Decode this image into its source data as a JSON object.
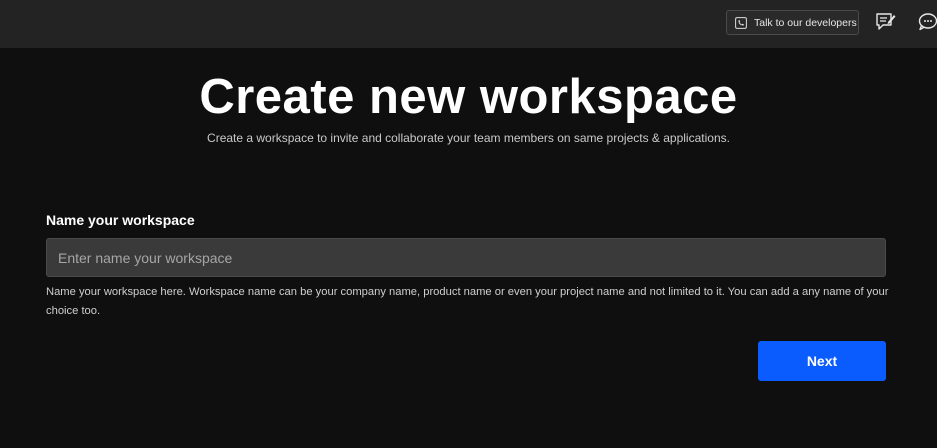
{
  "topbar": {
    "talk_button_label": "Talk to our developers",
    "icons": {
      "talk": "phone-icon",
      "feedback": "feedback-icon",
      "chat": "chat-icon"
    }
  },
  "main": {
    "title": "Create new workspace",
    "subtitle": "Create a workspace to invite and collaborate your team members on same projects & applications.",
    "field_label": "Name your workspace",
    "input_value": "",
    "input_placeholder": "Enter name your workspace",
    "help_text": "Name your workspace here. Workspace name can be your company name, product name or even your project name and not limited to it. You can add a any name of your choice too.",
    "next_label": "Next"
  },
  "colors": {
    "background": "#0f0f0f",
    "topbar": "#232323",
    "input_bg": "#3a3a3a",
    "primary": "#0a5cff"
  }
}
